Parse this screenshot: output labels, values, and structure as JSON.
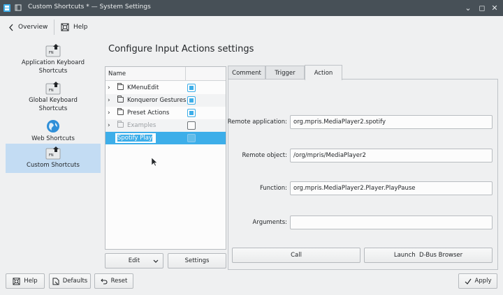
{
  "window": {
    "title": "Custom Shortcuts * — System Settings"
  },
  "topbar": {
    "overview_label": "Overview",
    "help_label": "Help"
  },
  "sidebar": {
    "items": [
      {
        "label": "Application Keyboard Shortcuts",
        "icon": "keyboard-fn-icon"
      },
      {
        "label": "Global Keyboard Shortcuts",
        "icon": "keyboard-fn-icon"
      },
      {
        "label": "Web Shortcuts",
        "icon": "globe-icon"
      },
      {
        "label": "Custom Shortcuts",
        "icon": "keyboard-fn-icon",
        "selected": true
      }
    ]
  },
  "page": {
    "heading": "Configure Input Actions settings"
  },
  "tree": {
    "column_name": "Name",
    "rows": [
      {
        "label": "KMenuEdit",
        "checked": true
      },
      {
        "label": "Konqueror Gestures",
        "checked": true
      },
      {
        "label": "Preset Actions",
        "checked": true
      },
      {
        "label": "Examples",
        "checked": false
      },
      {
        "label": "Spotify Play",
        "editing": true
      }
    ],
    "edit_button": "Edit",
    "settings_button": "Settings"
  },
  "tabs": {
    "items": [
      "Comment",
      "Trigger",
      "Action"
    ],
    "active": "Action"
  },
  "action_form": {
    "remote_application_label": "Remote application:",
    "remote_application_value": "org.mpris.MediaPlayer2.spotify",
    "remote_object_label": "Remote object:",
    "remote_object_value": "/org/mpris/MediaPlayer2",
    "function_label": "Function:",
    "function_value": "org.mpris.MediaPlayer2.Player.PlayPause",
    "arguments_label": "Arguments:",
    "arguments_value": "",
    "call_button": "Call",
    "launch_button": "Launch  D-Bus Browser"
  },
  "bottombar": {
    "help_label": "Help",
    "defaults_label": "Defaults",
    "reset_label": "Reset",
    "apply_label": "Apply"
  },
  "colors": {
    "accent": "#3daee9",
    "titlebar": "#475057",
    "window_bg": "#eff0f1",
    "selection_bg": "#c3dcf3"
  }
}
